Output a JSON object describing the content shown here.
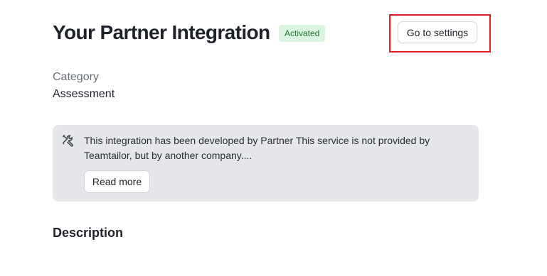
{
  "header": {
    "title": "Your Partner Integration",
    "status_badge": "Activated",
    "settings_button": "Go to settings"
  },
  "details": {
    "category_label": "Category",
    "category_value": "Assessment"
  },
  "notice": {
    "icon": "tools-icon",
    "text": "This integration has been developed by Partner This service is not provided by Teamtailor, but by another company....",
    "read_more_label": "Read more"
  },
  "sections": {
    "description_heading": "Description"
  },
  "colors": {
    "badge_bg": "#dcf5e0",
    "badge_text": "#1e7a35",
    "highlight": "#e01b24",
    "notice_bg": "#e6e7ea"
  }
}
